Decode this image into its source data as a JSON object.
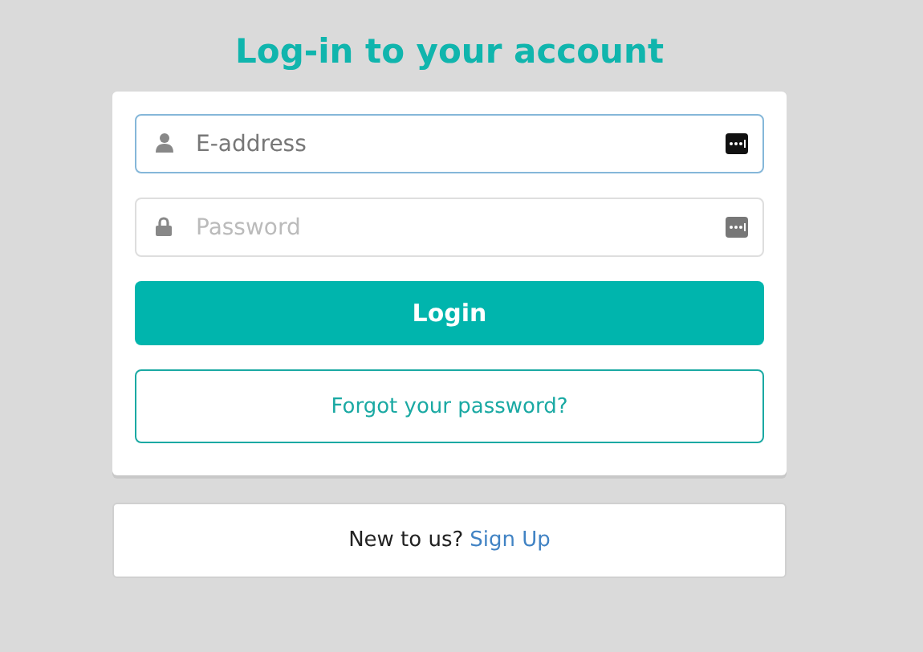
{
  "title": "Log-in to your account",
  "fields": [
    {
      "kind": "user",
      "placeholder": "E-address",
      "focused": true
    },
    {
      "kind": "lock",
      "placeholder": "Password",
      "focused": false
    }
  ],
  "login_button": "Login",
  "forgot_button": "Forgot your password?",
  "signup": {
    "text": "New to us?",
    "link": "Sign Up"
  }
}
